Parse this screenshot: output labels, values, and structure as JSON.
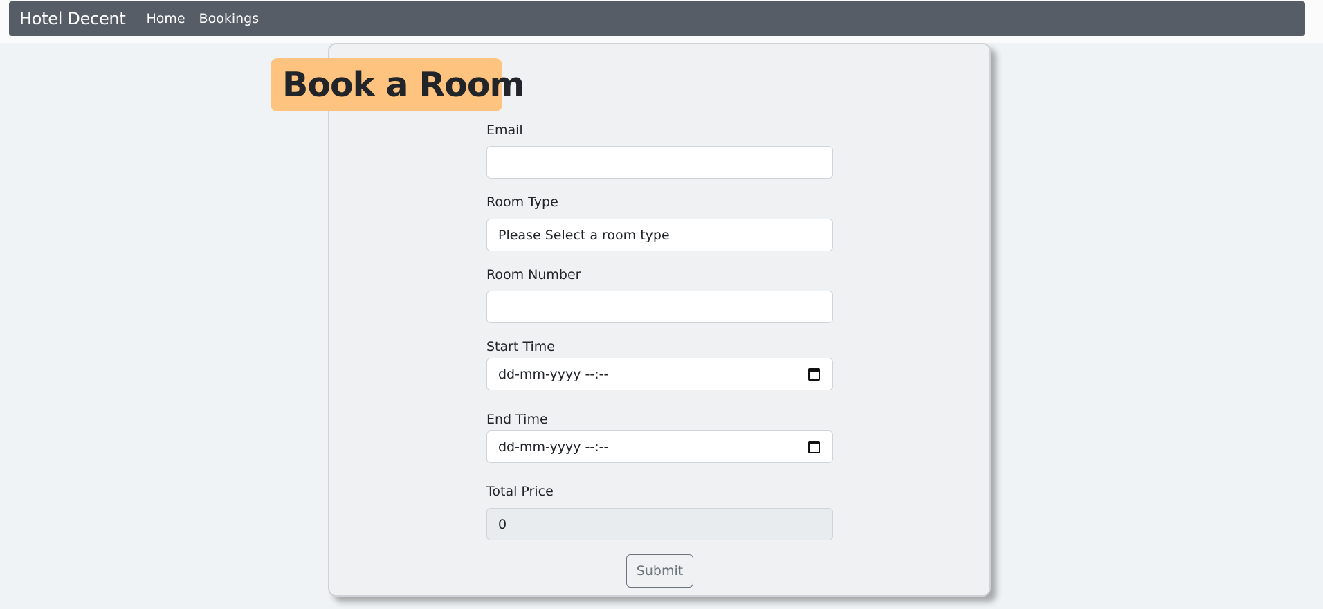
{
  "navbar": {
    "brand": "Hotel Decent",
    "links": [
      "Home",
      "Bookings"
    ]
  },
  "page": {
    "title": "Book a Room"
  },
  "form": {
    "email": {
      "label": "Email",
      "value": ""
    },
    "room_type": {
      "label": "Room Type",
      "value": "Please Select a room type"
    },
    "room_number": {
      "label": "Room Number",
      "value": ""
    },
    "start_time": {
      "label": "Start Time",
      "placeholder": "dd-mm-yyyy --:--"
    },
    "end_time": {
      "label": "End Time",
      "placeholder": "dd-mm-yyyy --:--"
    },
    "total_price": {
      "label": "Total Price",
      "value": "0"
    },
    "submit_label": "Submit"
  },
  "icons": {
    "calendar": "calendar-icon"
  },
  "colors": {
    "navbar_bg": "#575d66",
    "title_badge_bg": "#fec47f",
    "page_bg": "#eff3f5",
    "card_bg": "#f0f1f3"
  }
}
